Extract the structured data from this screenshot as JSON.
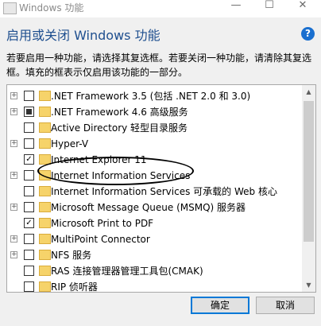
{
  "window": {
    "title": "Windows 功能",
    "minimize_glyph": "—",
    "maximize_glyph": "☐",
    "close_glyph": "✕"
  },
  "header": {
    "title": "启用或关闭 Windows 功能",
    "help_glyph": "?"
  },
  "description": "若要启用一种功能，请选择其复选框。若要关闭一种功能，请清除其复选框。填充的框表示仅启用该功能的一部分。",
  "features": [
    {
      "label": ".NET Framework 3.5 (包括 .NET 2.0 和 3.0)",
      "expandable": true,
      "state": "unchecked"
    },
    {
      "label": ".NET Framework 4.6 高级服务",
      "expandable": true,
      "state": "partial"
    },
    {
      "label": "Active Directory 轻型目录服务",
      "expandable": false,
      "state": "unchecked"
    },
    {
      "label": "Hyper-V",
      "expandable": true,
      "state": "unchecked"
    },
    {
      "label": "Internet Explorer 11",
      "expandable": false,
      "state": "checked"
    },
    {
      "label": "Internet Information Services",
      "expandable": true,
      "state": "unchecked"
    },
    {
      "label": "Internet Information Services 可承载的 Web 核心",
      "expandable": false,
      "state": "unchecked"
    },
    {
      "label": "Microsoft Message Queue (MSMQ) 服务器",
      "expandable": true,
      "state": "unchecked"
    },
    {
      "label": "Microsoft Print to PDF",
      "expandable": false,
      "state": "checked"
    },
    {
      "label": "MultiPoint Connector",
      "expandable": true,
      "state": "unchecked"
    },
    {
      "label": "NFS 服务",
      "expandable": true,
      "state": "unchecked"
    },
    {
      "label": "RAS 连接管理器管理工具包(CMAK)",
      "expandable": false,
      "state": "unchecked"
    },
    {
      "label": "RIP 侦听器",
      "expandable": false,
      "state": "unchecked"
    }
  ],
  "scroll": {
    "up_glyph": "▲",
    "down_glyph": "▼"
  },
  "buttons": {
    "ok": "确定",
    "cancel": "取消"
  },
  "colors": {
    "heading": "#1f4f8f",
    "accent": "#0078d7",
    "folder": "#f6d36a"
  }
}
